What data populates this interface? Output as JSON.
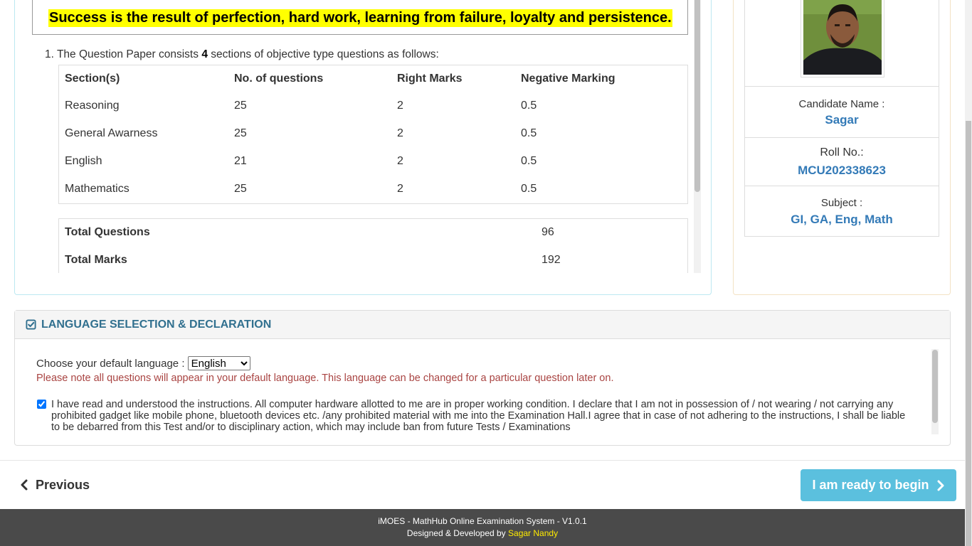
{
  "instructions": {
    "quote": "Success is the result of perfection, hard work, learning from failure, loyalty and persistence.",
    "item_number": "1.",
    "item_text_before": "The Question Paper consists",
    "item_sections_count": "4",
    "item_text_after": "sections of objective type questions as follows:",
    "section_table": {
      "headers": [
        "Section(s)",
        "No. of questions",
        "Right Marks",
        "Negative Marking"
      ],
      "rows": [
        [
          "Reasoning",
          "25",
          "2",
          "0.5"
        ],
        [
          "General Awarness",
          "25",
          "2",
          "0.5"
        ],
        [
          "English",
          "21",
          "2",
          "0.5"
        ],
        [
          "Mathematics",
          "25",
          "2",
          "0.5"
        ]
      ]
    },
    "totals": {
      "total_questions_label": "Total Questions",
      "total_questions_value": "96",
      "total_marks_label": "Total Marks",
      "total_marks_value": "192"
    }
  },
  "candidate": {
    "name_label": "Candidate Name :",
    "name": "Sagar",
    "roll_label": "Roll No.:",
    "roll": "MCU202338623",
    "subject_label": "Subject :",
    "subject": "GI, GA, Eng, Math"
  },
  "language_panel": {
    "title": "LANGUAGE SELECTION & DECLARATION",
    "choose_label": "Choose your default language :",
    "selected_language": "English",
    "note": "Please note all questions will appear in your default language. This language can be changed for a particular question later on.",
    "declaration": "I have read and understood the instructions. All computer hardware allotted to me are in proper working condition. I declare that I am not in possession of / not wearing / not carrying any prohibited gadget like mobile phone, bluetooth devices etc. /any prohibited material with me into the Examination Hall.I agree that in case of not adhering to the instructions, I shall be liable to be debarred from this Test and/or to disciplinary action, which may include ban from future Tests / Examinations",
    "declaration_checked": true
  },
  "nav": {
    "previous_label": "Previous",
    "begin_label": "I am ready to begin"
  },
  "footer": {
    "line1": "iMOES - MathHub Online Examination System - V1.0.1",
    "designed_by": "Designed & Developed by",
    "developer": "Sagar Nandy"
  },
  "colors": {
    "accent_blue": "#337ab7",
    "panel_title": "#31708f",
    "warning_red": "#a94442",
    "begin_button": "#5bc0de",
    "quote_highlight": "#ffff00",
    "footer_bg": "#4a4a4a",
    "developer_link": "#ffeb00"
  },
  "icons": {
    "panel_icon": "check-square-icon",
    "previous_icon": "chevron-left-icon",
    "begin_icon": "chevron-right-icon"
  }
}
